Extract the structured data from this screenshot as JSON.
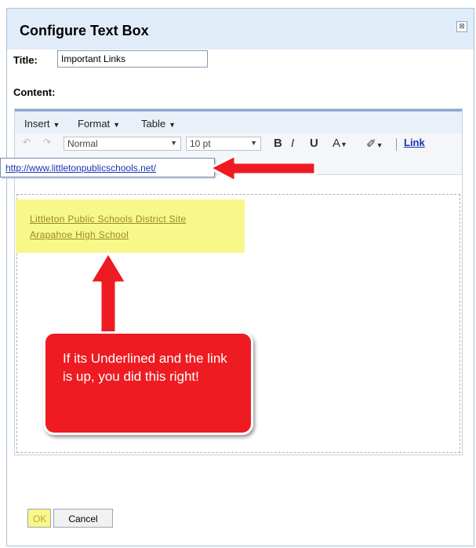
{
  "dialog": {
    "title": "Configure Text Box",
    "close_glyph": "⊠"
  },
  "form": {
    "title_label": "Title:",
    "title_value": "Important Links",
    "content_label": "Content:"
  },
  "menubar": {
    "items": [
      "Insert",
      "Format",
      "Table"
    ]
  },
  "format_toolbar": {
    "style_value": "Normal",
    "size_value": "10 pt",
    "bold": "B",
    "italic": "I",
    "underline": "U",
    "font_color": "A",
    "highlight_glyph": "✐",
    "link_label": "Link"
  },
  "content": {
    "links": [
      "Littleton Public Schools District Site",
      "Arapahoe High School"
    ]
  },
  "link_bubble": {
    "url": "http://www.littletonpublicschools.net/"
  },
  "callout": {
    "text": "If its Underlined and the link is up, you did this right!"
  },
  "buttons": {
    "ok": "OK",
    "cancel": "Cancel"
  },
  "colors": {
    "annotation_red": "#ee1c22",
    "highlight_yellow": "#f7f78a",
    "titlebar_blue": "#e0ecf7"
  }
}
